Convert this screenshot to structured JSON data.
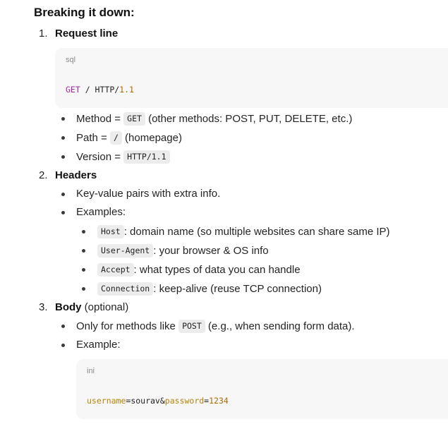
{
  "heading": "Breaking it down:",
  "sections": [
    {
      "number": "1.",
      "title": "Request line",
      "code": {
        "lang": "sql",
        "keyword": "GET",
        "middle": " / HTTP/",
        "version": "1.1"
      },
      "bullets": [
        {
          "prefix": "Method = ",
          "code": "GET",
          "suffix": " (other methods: POST, PUT, DELETE, etc.)"
        },
        {
          "prefix": "Path = ",
          "code": "/",
          "suffix": " (homepage)"
        },
        {
          "prefix": "Version = ",
          "code": "HTTP/1.1",
          "suffix": ""
        }
      ]
    },
    {
      "number": "2.",
      "title": "Headers",
      "bullets": [
        {
          "text": "Key-value pairs with extra info."
        },
        {
          "text": "Examples:"
        }
      ],
      "sub_bullets": [
        {
          "code": "Host",
          "suffix": ": domain name (so multiple websites can share same IP)"
        },
        {
          "code": "User-Agent",
          "suffix": ": your browser & OS info"
        },
        {
          "code": "Accept",
          "suffix": ": what types of data you can handle"
        },
        {
          "code": "Connection",
          "suffix": ": keep-alive (reuse TCP connection)"
        }
      ]
    },
    {
      "number": "3.",
      "title": "Body",
      "title_suffix": " (optional)",
      "bullets": [
        {
          "prefix": "Only for methods like ",
          "code": "POST",
          "suffix": " (e.g., when sending form data)."
        },
        {
          "text": "Example:"
        }
      ],
      "code": {
        "lang": "ini",
        "k1": "username",
        "eq1": "=sourav&",
        "k2": "password",
        "eq2": "=",
        "v2": "1234"
      }
    }
  ]
}
